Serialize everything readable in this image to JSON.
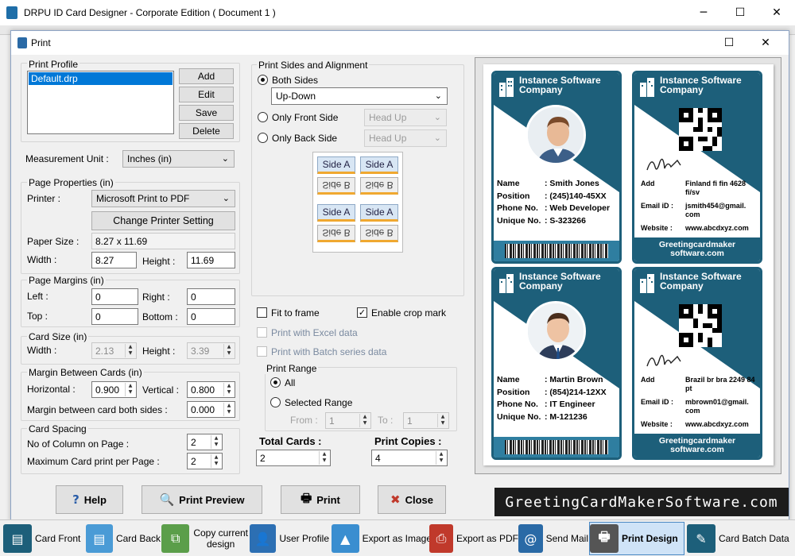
{
  "app": {
    "title": "DRPU ID Card Designer - Corporate Edition ( Document 1 )"
  },
  "window_controls": {
    "minimize": "─",
    "maximize": "☐",
    "close": "✕"
  },
  "dialog": {
    "title": "Print",
    "print_profile": {
      "legend": "Print Profile",
      "selected": "Default.drp",
      "add": "Add",
      "edit": "Edit",
      "save": "Save",
      "delete": "Delete"
    },
    "measurement_unit": {
      "label": "Measurement Unit :",
      "value": "Inches (in)"
    },
    "page_properties": {
      "legend": "Page Properties (in)",
      "printer_label": "Printer :",
      "printer_value": "Microsoft Print to PDF",
      "change_printer": "Change Printer Setting",
      "paper_size_label": "Paper Size :",
      "paper_size_value": "8.27 x 11.69",
      "width_label": "Width :",
      "width_value": "8.27",
      "height_label": "Height :",
      "height_value": "11.69"
    },
    "page_margins": {
      "legend": "Page Margins (in)",
      "left_label": "Left :",
      "left_value": "0",
      "right_label": "Right :",
      "right_value": "0",
      "top_label": "Top :",
      "top_value": "0",
      "bottom_label": "Bottom :",
      "bottom_value": "0"
    },
    "card_size": {
      "legend": "Card Size (in)",
      "width_label": "Width :",
      "width_value": "2.13",
      "height_label": "Height :",
      "height_value": "3.39"
    },
    "margin_between_cards": {
      "legend": "Margin Between Cards (in)",
      "horizontal_label": "Horizontal :",
      "horizontal_value": "0.900",
      "vertical_label": "Vertical :",
      "vertical_value": "0.800",
      "both_sides_label": "Margin between card both sides :",
      "both_sides_value": "0.000"
    },
    "card_spacing": {
      "legend": "Card Spacing",
      "columns_label": "No of Column on Page :",
      "columns_value": "2",
      "max_cards_label": "Maximum Card print per Page :",
      "max_cards_value": "2"
    },
    "print_sides": {
      "legend": "Print Sides and Alignment",
      "both_sides": "Both Sides",
      "alignment_value": "Up-Down",
      "front_only": "Only Front Side",
      "front_value": "Head Up",
      "back_only": "Only Back Side",
      "back_value": "Head Up",
      "side_a": "Side A",
      "side_b": "Side B"
    },
    "options": {
      "fit_to_frame": "Fit to frame",
      "enable_crop_mark": "Enable crop mark",
      "excel": "Print with Excel data",
      "batch": "Print with Batch series data"
    },
    "print_range": {
      "legend": "Print Range",
      "all": "All",
      "selected": "Selected Range",
      "from_label": "From :",
      "from_value": "1",
      "to_label": "To :",
      "to_value": "1"
    },
    "totals": {
      "total_cards_label": "Total Cards :",
      "total_cards_value": "2",
      "copies_label": "Print Copies :",
      "copies_value": "4"
    },
    "buttons": {
      "help": "Help",
      "preview": "Print Preview",
      "print": "Print",
      "close": "Close"
    }
  },
  "cards": [
    {
      "company": "Instance Software Company",
      "name_label": "Name",
      "name": ": Smith Jones",
      "position_label": "Position",
      "position": ": (245)140-45XX",
      "phone_label": "Phone No.",
      "phone": ": Web Developer",
      "unique_label": "Unique No.",
      "unique": ": S-323266",
      "add_label": "Add",
      "address": "Finland fi fin 4628 fi/sv",
      "email_label": "Email iD :",
      "email": "jsmith454@gmail. com",
      "website_label": "Website :",
      "website": "www.abcdxyz.com",
      "footer": "Greetingcardmaker software.com"
    },
    {
      "company": "Instance Software Company",
      "name_label": "Name",
      "name": ": Martin Brown",
      "position_label": "Position",
      "position": ": (854)214-12XX",
      "phone_label": "Phone No.",
      "phone": ": IT Engineer",
      "unique_label": "Unique No.",
      "unique": ": M-121236",
      "add_label": "Add",
      "address": "Brazil br bra 2249 84 pt",
      "email_label": "Email iD :",
      "email": "mbrown01@gmail. com",
      "website_label": "Website :",
      "website": "www.abcdxyz.com",
      "footer": "Greetingcardmaker software.com"
    }
  ],
  "watermark": "GreetingCardMakerSoftware.com",
  "taskbar": {
    "card_front": "Card Front",
    "card_back": "Card Back",
    "copy_design": "Copy current design",
    "user_profile": "User Profile",
    "export_image": "Export as Image",
    "export_pdf": "Export as PDF",
    "send_mail": "Send Mail",
    "print_design": "Print Design",
    "batch_data": "Card Batch Data"
  }
}
